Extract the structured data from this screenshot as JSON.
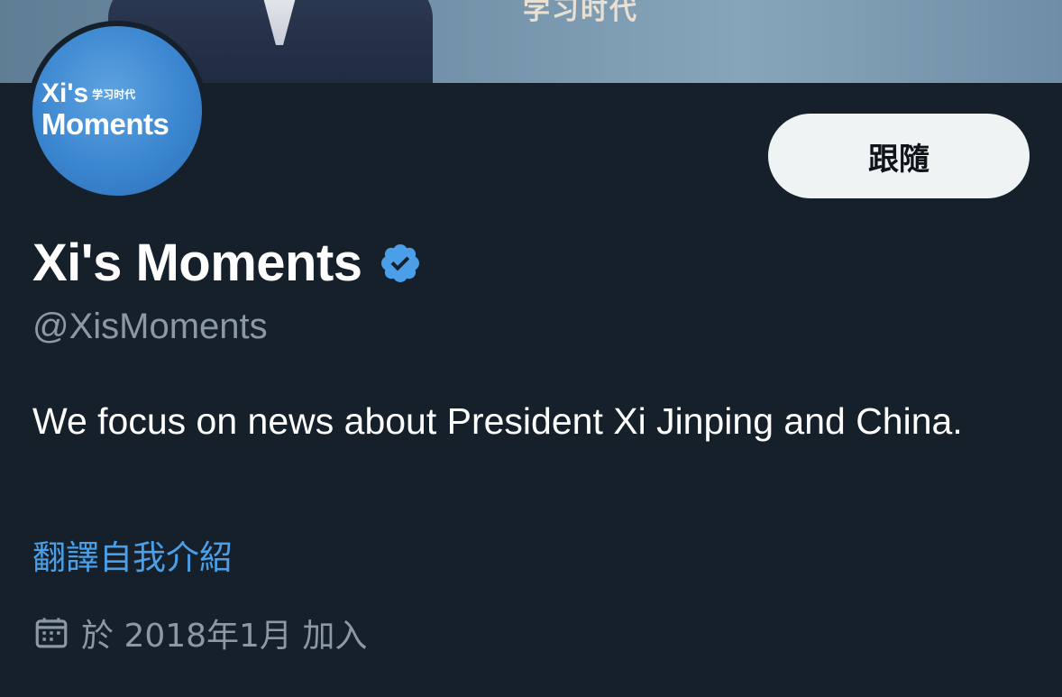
{
  "banner": {
    "caption": "学习时代"
  },
  "avatar": {
    "line1": "Xi's",
    "line1_zh": "学习时代",
    "line2": "Moments"
  },
  "actions": {
    "follow_label": "跟隨"
  },
  "profile": {
    "display_name": "Xi's Moments",
    "verified_icon": "verified-badge-icon",
    "handle": "@XisMoments",
    "bio": "We focus on news about President Xi Jinping and China.",
    "translate_bio": "翻譯自我介紹",
    "joined_icon": "calendar-icon",
    "joined": "於 2018年1月 加入"
  },
  "colors": {
    "background": "#15202b",
    "link": "#4a9fe8",
    "verified": "#4a9fe8",
    "secondary_text": "#8b98a5",
    "button_bg": "#eff3f4"
  }
}
